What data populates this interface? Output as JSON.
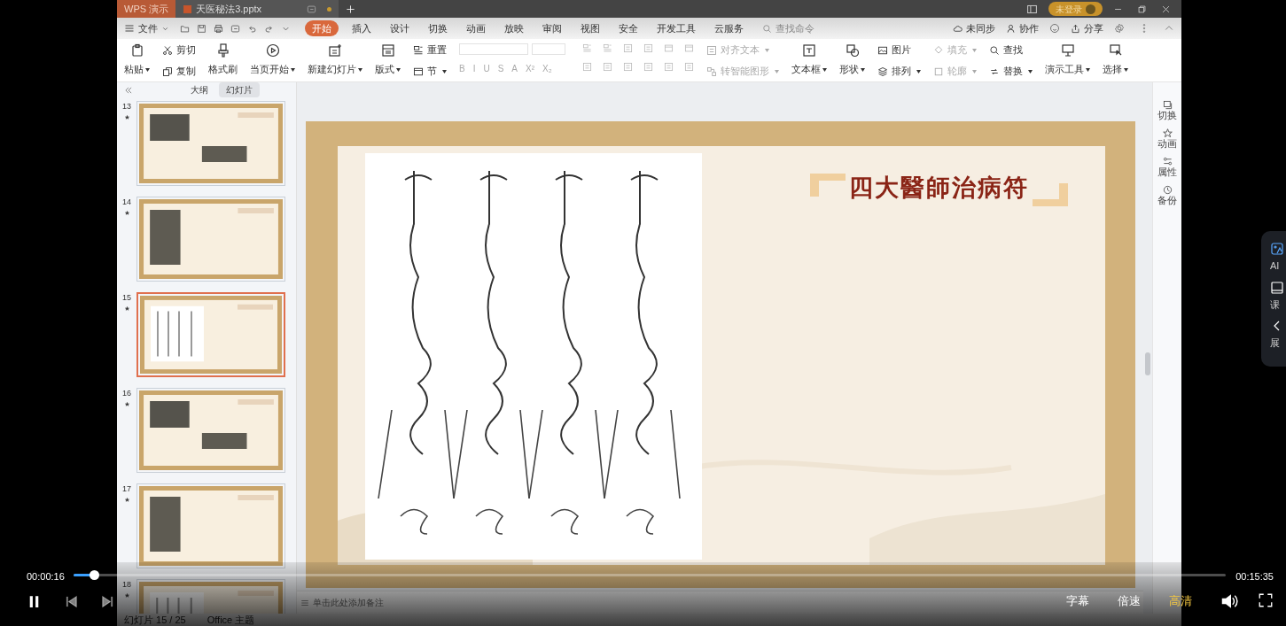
{
  "title_bar": {
    "app_tab": "WPS 演示",
    "document_tab": "天医秘法3.pptx",
    "user": "未登录"
  },
  "menu_bar": {
    "file_menu": "文件",
    "tabs": [
      {
        "label": "开始",
        "selected": true
      },
      {
        "label": "插入",
        "selected": false
      },
      {
        "label": "设计",
        "selected": false
      },
      {
        "label": "切换",
        "selected": false
      },
      {
        "label": "动画",
        "selected": false
      },
      {
        "label": "放映",
        "selected": false
      },
      {
        "label": "审阅",
        "selected": false
      },
      {
        "label": "视图",
        "selected": false
      },
      {
        "label": "安全",
        "selected": false
      },
      {
        "label": "开发工具",
        "selected": false
      },
      {
        "label": "云服务",
        "selected": false
      }
    ],
    "search": {
      "placeholder": "查找命令"
    },
    "actions": [
      "未同步",
      "协作",
      "分享"
    ]
  },
  "ribbon": {
    "groups": [
      {
        "kind": "large",
        "items": [
          {
            "label": "粘贴",
            "dropdown": true,
            "disabled": false
          }
        ]
      },
      {
        "kind": "stack",
        "items": [
          {
            "label": "剪切",
            "dropdown": false,
            "disabled": false
          },
          {
            "label": "复制",
            "dropdown": false,
            "disabled": false
          }
        ]
      },
      {
        "kind": "large",
        "items": [
          {
            "label": "格式刷",
            "dropdown": false,
            "disabled": false
          }
        ]
      },
      {
        "kind": "large",
        "items": [
          {
            "label": "当页开始",
            "dropdown": true,
            "disabled": false
          }
        ]
      },
      {
        "kind": "large",
        "items": [
          {
            "label": "新建幻灯片",
            "dropdown": true,
            "disabled": false
          }
        ]
      },
      {
        "kind": "large",
        "items": [
          {
            "label": "版式",
            "dropdown": true,
            "disabled": false
          }
        ]
      },
      {
        "kind": "stack",
        "items": [
          {
            "label": "重置",
            "dropdown": false,
            "disabled": false
          },
          {
            "label": "节",
            "dropdown": true,
            "disabled": false
          }
        ]
      },
      {
        "kind": "font",
        "buttons": [
          "B",
          "I",
          "U",
          "S",
          "A",
          "X²",
          "X₂"
        ]
      },
      {
        "kind": "paragraph"
      },
      {
        "kind": "stack",
        "items": [
          {
            "label": "对齐文本",
            "dropdown": true,
            "disabled": true
          },
          {
            "label": "转智能图形",
            "dropdown": true,
            "disabled": true
          }
        ]
      },
      {
        "kind": "large",
        "items": [
          {
            "label": "文本框",
            "dropdown": true,
            "disabled": false
          }
        ]
      },
      {
        "kind": "large",
        "items": [
          {
            "label": "形状",
            "dropdown": true,
            "disabled": false
          }
        ]
      },
      {
        "kind": "stack",
        "items": [
          {
            "label": "图片",
            "dropdown": false,
            "disabled": false
          },
          {
            "label": "排列",
            "dropdown": true,
            "disabled": false
          }
        ]
      },
      {
        "kind": "stack",
        "items": [
          {
            "label": "填充",
            "dropdown": true,
            "disabled": true
          },
          {
            "label": "轮廓",
            "dropdown": true,
            "disabled": true
          }
        ]
      },
      {
        "kind": "stack",
        "items": [
          {
            "label": "查找",
            "dropdown": false,
            "disabled": false
          },
          {
            "label": "替换",
            "dropdown": true,
            "disabled": false
          }
        ]
      },
      {
        "kind": "large",
        "items": [
          {
            "label": "演示工具",
            "dropdown": true,
            "disabled": false
          }
        ]
      },
      {
        "kind": "large",
        "items": [
          {
            "label": "选择",
            "dropdown": true,
            "disabled": false
          }
        ]
      }
    ]
  },
  "slide_panel": {
    "tabs": [
      {
        "label": "大纲",
        "selected": false
      },
      {
        "label": "幻灯片",
        "selected": true
      }
    ],
    "thumbnails": [
      {
        "number": "13",
        "selected": false
      },
      {
        "number": "14",
        "selected": false
      },
      {
        "number": "15",
        "selected": true
      },
      {
        "number": "16",
        "selected": false
      },
      {
        "number": "17",
        "selected": false
      },
      {
        "number": "18",
        "selected": false
      }
    ]
  },
  "slide": {
    "title": "四大醫師治病符"
  },
  "notes": {
    "placeholder": "单击此处添加备注"
  },
  "status_bar": [
    "幻灯片 15 / 25",
    "Office 主题"
  ],
  "right_sidebar": [
    "切换",
    "动画",
    "属性",
    "备份"
  ],
  "player": {
    "current_time": "00:00:16",
    "total_time": "00:15:35",
    "level": 0.018,
    "options": [
      {
        "label": "字幕",
        "selected": false
      },
      {
        "label": "倍速",
        "selected": false
      },
      {
        "label": "高清",
        "selected": true
      }
    ]
  },
  "side_panel": [
    "AI",
    "课",
    "展"
  ]
}
